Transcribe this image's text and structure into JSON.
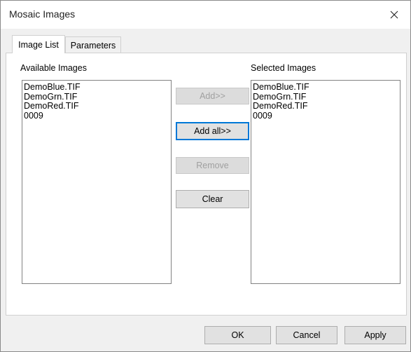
{
  "window": {
    "title": "Mosaic Images",
    "close_icon": "close-icon"
  },
  "tabs": [
    {
      "label": "Image List",
      "active": true
    },
    {
      "label": "Parameters",
      "active": false
    }
  ],
  "available": {
    "label": "Available Images",
    "items": [
      "DemoBlue.TIF",
      "DemoGrn.TIF",
      "DemoRed.TIF",
      "0009"
    ]
  },
  "selected": {
    "label": "Selected Images",
    "items": [
      "DemoBlue.TIF",
      "DemoGrn.TIF",
      "DemoRed.TIF",
      "0009"
    ]
  },
  "actions": {
    "add": "Add>>",
    "add_all": "Add all>>",
    "remove": "Remove",
    "clear": "Clear"
  },
  "footer": {
    "ok": "OK",
    "cancel": "Cancel",
    "apply": "Apply"
  }
}
